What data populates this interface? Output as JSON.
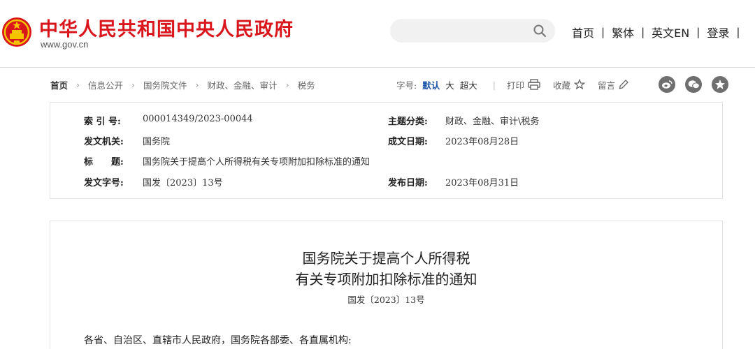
{
  "header": {
    "site_name": "中华人民共和国中央人民政府",
    "site_url": "www.gov.cn",
    "search": {
      "placeholder": ""
    },
    "nav": [
      {
        "label": "首页"
      },
      {
        "label": "繁体"
      },
      {
        "label": "英文EN"
      },
      {
        "label": "登录"
      }
    ],
    "nav_separator": "|"
  },
  "breadcrumb": {
    "items": [
      "首页",
      "信息公开",
      "国务院文件",
      "财政、金融、审计",
      "税务"
    ],
    "arrow": "›"
  },
  "toolbar": {
    "font_size_label": "字号:",
    "font_sizes": [
      "默认",
      "大",
      "超大"
    ],
    "active_font_size": "默认",
    "divider": "|",
    "print_label": "打印",
    "favorite_label": "收藏",
    "comment_label": "留言"
  },
  "share": {
    "buttons": [
      {
        "icon": "weibo-icon"
      },
      {
        "icon": "wechat-icon"
      },
      {
        "icon": "qzone-icon"
      }
    ]
  },
  "info": {
    "index_label": "索 引 号:",
    "index_value": "000014349/2023-00044",
    "category_label": "主题分类:",
    "category_value": "财政、金融、审计\\税务",
    "issuer_label": "发文机关:",
    "issuer_value": "国务院",
    "created_label": "成文日期:",
    "created_value": "2023年08月28日",
    "title_label": "标　　题:",
    "title_value": "国务院关于提高个人所得税有关专项附加扣除标准的通知",
    "doc_no_label": "发文字号:",
    "doc_no_value": "国发〔2023〕13号",
    "published_label": "发布日期:",
    "published_value": "2023年08月31日"
  },
  "document": {
    "title_line1": "国务院关于提高个人所得税",
    "title_line2": "有关专项附加扣除标准的通知",
    "number": "国发〔2023〕13号",
    "addressee": "各省、自治区、直辖市人民政府，国务院各部委、各直属机构:"
  },
  "colors": {
    "brand_red": "#d9161c",
    "active_blue": "#1d56a8",
    "share_gray": "#6f6f6f"
  }
}
